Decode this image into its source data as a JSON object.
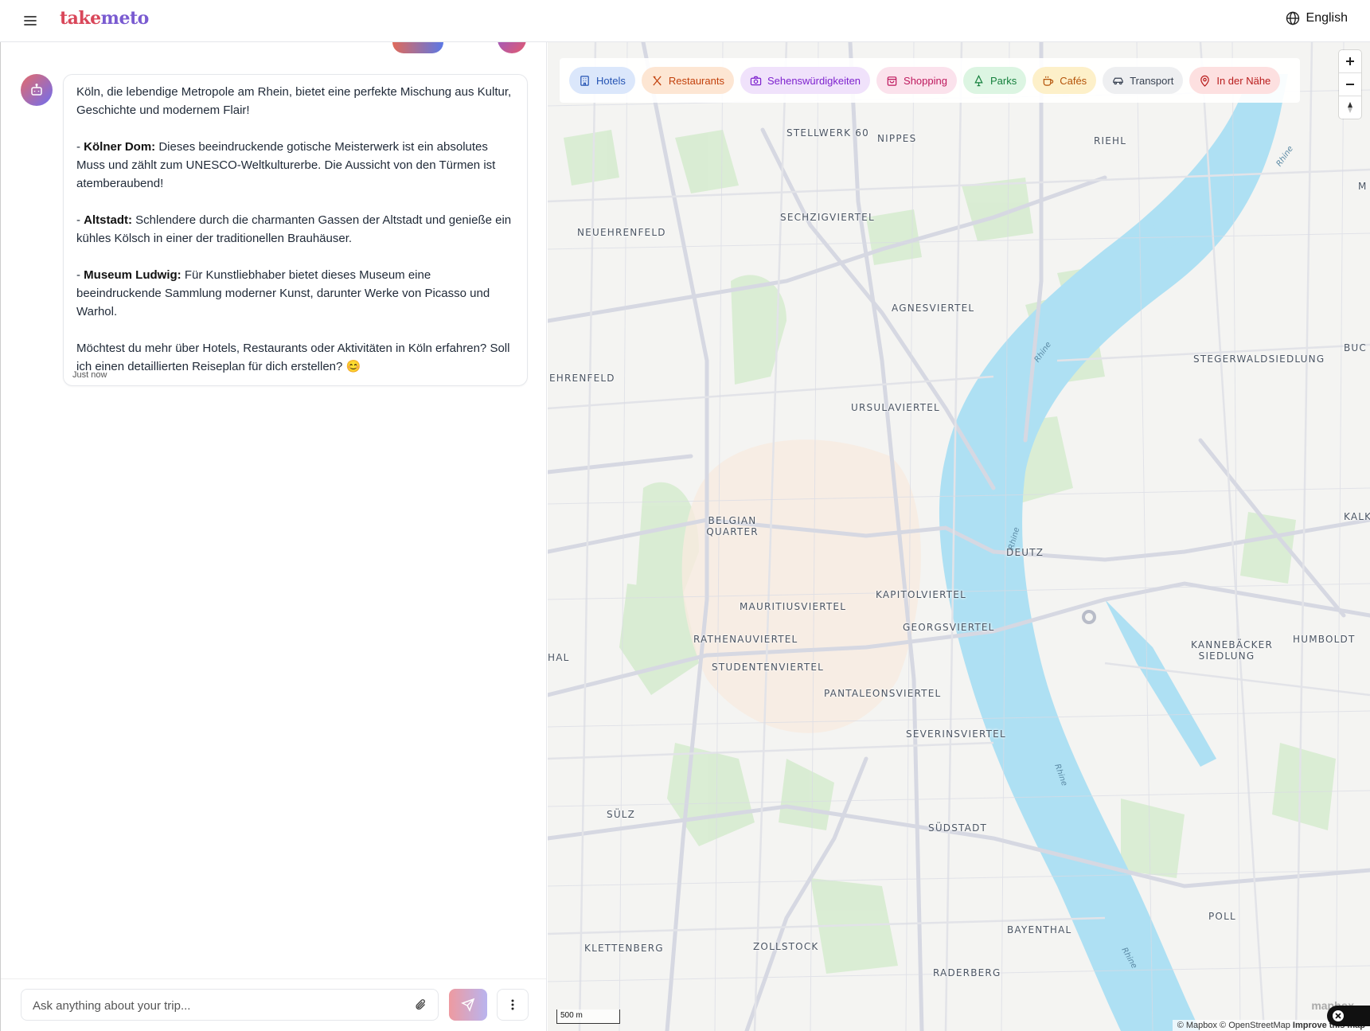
{
  "app": {
    "logo_part1": "take",
    "logo_part2": "meto"
  },
  "header": {
    "language": "English"
  },
  "chat": {
    "message": {
      "intro": "Köln, die lebendige Metropole am Rhein, bietet eine perfekte Mischung aus Kultur, Geschichte und modernem Flair!",
      "items": [
        {
          "title": "Kölner Dom:",
          "text": " Dieses beeindruckende gotische Meisterwerk ist ein absolutes Muss und zählt zum UNESCO-Weltkulturerbe. Die Aussicht von den Türmen ist atemberaubend!"
        },
        {
          "title": "Altstadt:",
          "text": " Schlendere durch die charmanten Gassen der Altstadt und genieße ein kühles Kölsch in einer der traditionellen Brauhäuser."
        },
        {
          "title": "Museum Ludwig:",
          "text": " Für Kunstliebhaber bietet dieses Museum eine beeindruckende Sammlung moderner Kunst, darunter Werke von Picasso und Warhol."
        }
      ],
      "outro": "Möchtest du mehr über Hotels, Restaurants oder Aktivitäten in Köln erfahren? Soll ich einen detaillierten Reiseplan für dich erstellen? 😊",
      "timestamp": "Just now"
    },
    "composer": {
      "placeholder": "Ask anything about your trip..."
    }
  },
  "map": {
    "filters": [
      {
        "label": "Hotels",
        "icon": "hotel-icon",
        "bg": "#dbe7fb",
        "color": "#2453b3"
      },
      {
        "label": "Restaurants",
        "icon": "utensils-icon",
        "bg": "#fde6d3",
        "color": "#c2410c"
      },
      {
        "label": "Sehenswürdigkeiten",
        "icon": "camera-icon",
        "bg": "#f0e2fb",
        "color": "#7e22ce"
      },
      {
        "label": "Shopping",
        "icon": "shopping-bag-icon",
        "bg": "#fbe2ec",
        "color": "#be185d"
      },
      {
        "label": "Parks",
        "icon": "tree-icon",
        "bg": "#dcf5e2",
        "color": "#15803d"
      },
      {
        "label": "Cafés",
        "icon": "coffee-icon",
        "bg": "#fdf0c9",
        "color": "#b45309"
      },
      {
        "label": "Transport",
        "icon": "car-icon",
        "bg": "#eeeff1",
        "color": "#374151"
      },
      {
        "label": "In der Nähe",
        "icon": "map-pin-icon",
        "bg": "#fde0e0",
        "color": "#b91c1c"
      }
    ],
    "districts": [
      "Stellwerk 60",
      "Nippes",
      "Riehl",
      "Sechzigviertel",
      "Neuehrenfeld",
      "Agnesviertel",
      "Ehrenfeld",
      "Stegerwaldsiedlung",
      "Ursulaviertel",
      "Belgian Quarter",
      "Deutz",
      "Kalk",
      "Mauritiusviertel",
      "Kapitolviertel",
      "Georgsviertel",
      "Rathenauviertel",
      "Kannebäcker Siedlung",
      "Humboldt",
      "Hal",
      "Studentenviertel",
      "Pantaleonsviertel",
      "Severinsviertel",
      "Sülz",
      "Südstadt",
      "Poll",
      "Bayenthal",
      "Klettenberg",
      "Zollstock",
      "Raderberg",
      "Buc",
      "M"
    ],
    "river_label": "Rhine",
    "scale": "500 m",
    "attribution": "© Mapbox © OpenStreetMap",
    "attribution_link": "Improve this map",
    "logo": "mapbox"
  }
}
